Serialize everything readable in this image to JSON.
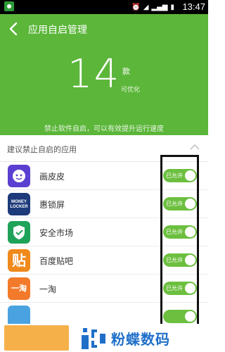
{
  "status_bar": {
    "time": "13:47"
  },
  "header": {
    "title": "应用自启管理",
    "count": "14",
    "count_unit": "款",
    "count_caption": "可优化",
    "tip": "禁止软件自启，可以有效提升运行速度"
  },
  "section": {
    "label": "建议禁止自启的应用"
  },
  "apps": [
    {
      "name": "画皮皮",
      "toggle_label": "已允许",
      "icon_color": "#5b3fd1",
      "icon": "face-icon"
    },
    {
      "name": "惠锁屏",
      "toggle_label": "已允许",
      "icon_color": "#1d3a7a",
      "icon": "money-locker-icon",
      "icon_text": "MONEY LOCKER"
    },
    {
      "name": "安全市场",
      "toggle_label": "已允许",
      "icon_color": "#1fa35a",
      "icon": "shield-store-icon"
    },
    {
      "name": "百度贴吧",
      "toggle_label": "已允许",
      "icon_color": "#f08a1c",
      "icon": "tieba-icon",
      "icon_text": "贴"
    },
    {
      "name": "一淘",
      "toggle_label": "已允许",
      "icon_color": "#f27a2a",
      "icon": "yitao-icon",
      "icon_text": "一淘"
    },
    {
      "name": "",
      "toggle_label": "",
      "icon_color": "#4aa3e0",
      "icon": "app-icon"
    }
  ],
  "footer": {
    "brand": "粉蝶数码"
  },
  "colors": {
    "accent": "#5bb63a",
    "toggle_on": "#6cbf3f",
    "brand": "#1f6fc9"
  }
}
